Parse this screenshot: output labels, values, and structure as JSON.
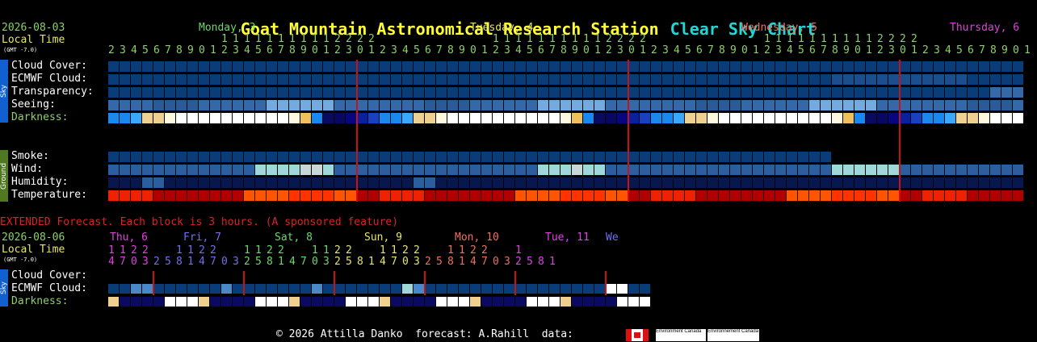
{
  "title": {
    "main": "Goat Mountain Astronomical Research Station",
    "sub": "Clear Sky Chart"
  },
  "header": {
    "date": "2026-08-03",
    "local_time": "Local Time",
    "gmt": "(GMT -7.0)",
    "days": [
      "Monday, 3",
      "Tuesday, 4",
      "Wednesday, 5",
      "Thursday, 6"
    ],
    "day_colors": [
      "#6cd86c",
      "#e6e66c",
      "#f07060",
      "#e040e0"
    ],
    "tens_row": [
      {
        "start": 10,
        "text": "11111111112222"
      },
      {
        "start": 34,
        "text": "11111111112222"
      },
      {
        "start": 58,
        "text": "11111111112222"
      },
      {
        "start": 82,
        "text": "11"
      }
    ],
    "hours": [
      "2",
      "3",
      "4",
      "5",
      "6",
      "7",
      "8",
      "9",
      "0",
      "1",
      "2",
      "3",
      "4",
      "5",
      "6",
      "7",
      "8",
      "9",
      "0",
      "1",
      "2",
      "3",
      "0",
      "1",
      "2",
      "3",
      "4",
      "5",
      "6",
      "7",
      "8",
      "9",
      "0",
      "1",
      "2",
      "3",
      "4",
      "5",
      "6",
      "7",
      "8",
      "9",
      "0",
      "1",
      "2",
      "3",
      "0",
      "1",
      "2",
      "3",
      "4",
      "5",
      "6",
      "7",
      "8",
      "9",
      "0",
      "1",
      "2",
      "3",
      "4",
      "5",
      "6",
      "7",
      "8",
      "9",
      "0",
      "1",
      "2",
      "3",
      "0",
      "1",
      "2",
      "3",
      "4",
      "5",
      "6",
      "7",
      "8",
      "9",
      "0",
      "1",
      "2",
      "3",
      "4",
      "5",
      "6",
      "7",
      "8",
      "9",
      "0",
      "1",
      "2",
      "3",
      "0",
      "1",
      "2",
      "3",
      "4",
      "5",
      "6",
      "7",
      "8",
      "9",
      "0",
      "1"
    ]
  },
  "sky_rows": [
    "Cloud Cover:",
    "ECMWF Cloud:",
    "Transparency:",
    "Seeing:",
    "Darkness:"
  ],
  "ground_rows": [
    "Smoke:",
    "Wind:",
    "Humidity:",
    "Temperature:"
  ],
  "sidebar": {
    "sky": "Sky",
    "ground": "Ground"
  },
  "colors": {
    "cloud": "#0a3c7a",
    "cloud_light": "#1a4e8e",
    "seeing_mid": "#3468a8",
    "seeing_light": "#74aae0",
    "smoke": "#0a3c7a",
    "wind_a": "#2b5e9e",
    "wind_b": "#9ed8d8",
    "humidity": "#08184e",
    "temp_a": "#ff5500",
    "temp_b": "#cc0000",
    "redline": "#cc1111"
  },
  "extended": {
    "header": "EXTENDED Forecast. Each block is 3 hours. (A sponsored feature)",
    "date": "2026-08-06",
    "local_time": "Local Time",
    "gmt": "(GMT -7.0)",
    "days": [
      {
        "label": "Thu, 6",
        "color": "#e040e0"
      },
      {
        "label": "Fri, 7",
        "color": "#7070f0"
      },
      {
        "label": "Sat, 8",
        "color": "#6cd86c"
      },
      {
        "label": "Sun, 9",
        "color": "#e6e66c"
      },
      {
        "label": "Mon, 10",
        "color": "#f07060"
      },
      {
        "label": "Tue, 11",
        "color": "#e040e0"
      },
      {
        "label": "We",
        "color": "#7070f0"
      }
    ],
    "tens": [
      "1",
      "1",
      "2",
      "2",
      "",
      "",
      "1",
      "1",
      "2",
      "2",
      "",
      "",
      "1",
      "1",
      "2",
      "2",
      "",
      "",
      "1",
      "1",
      "2",
      "2",
      "",
      "",
      "1",
      "1",
      "2",
      "2",
      "",
      "",
      "1",
      "1",
      "2",
      "2",
      "",
      "",
      "1"
    ],
    "ones": [
      "4",
      "7",
      "0",
      "3",
      "2",
      "5",
      "8",
      "1",
      "4",
      "7",
      "0",
      "3",
      "2",
      "5",
      "8",
      "1",
      "4",
      "7",
      "0",
      "3",
      "2",
      "5",
      "8",
      "1",
      "4",
      "7",
      "0",
      "3",
      "2",
      "5",
      "8",
      "1",
      "4",
      "7",
      "0",
      "3",
      "2",
      "5",
      "8",
      "1"
    ],
    "rows": [
      "Cloud Cover:",
      "ECMWF Cloud:",
      "Darkness:"
    ]
  },
  "footer": {
    "copyright": "© 2026 Attilla Danko  forecast: A.Rahill  data:",
    "env1": "Environment Canada",
    "env2": "Environnement Canada"
  }
}
